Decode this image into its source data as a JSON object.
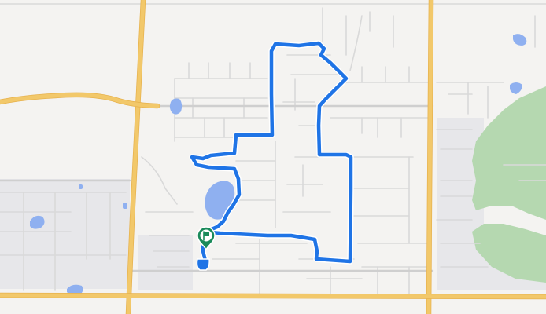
{
  "map": {
    "colors": {
      "background": "#f4f3f1",
      "major_road": "#f2c86a",
      "minor_road": "#d9d9d9",
      "water": "#8fb0f0",
      "park": "#b5d8b0",
      "route": "#1f74e6",
      "marker": "#1a8a5a"
    },
    "icons": {
      "start_marker": "flag-pin-icon",
      "end_marker": "route-end-icon"
    }
  }
}
